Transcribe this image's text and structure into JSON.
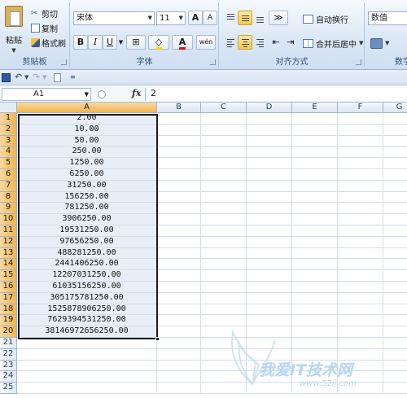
{
  "ribbon": {
    "clipboard": {
      "label": "剪贴板",
      "paste": "粘贴",
      "cut": "剪切",
      "copy": "复制",
      "format_painter": "格式刷"
    },
    "font": {
      "label": "字体",
      "font_name": "宋体",
      "font_size": "11",
      "grow": "A",
      "shrink": "A",
      "bold": "B",
      "italic": "I",
      "underline": "U",
      "font_color_letter": "A",
      "phonetic": "wén"
    },
    "alignment": {
      "label": "对齐方式",
      "wrap_text": "自动换行",
      "merge_center": "合并后居中"
    },
    "number": {
      "label": "数字",
      "format": "数值"
    }
  },
  "formula_bar": {
    "name_box": "A1",
    "fx": "fx",
    "value": "2"
  },
  "grid": {
    "columns": [
      "A",
      "B",
      "C",
      "D",
      "E",
      "F",
      "G"
    ],
    "rows": [
      "1",
      "2",
      "3",
      "4",
      "5",
      "6",
      "7",
      "8",
      "9",
      "10",
      "11",
      "12",
      "13",
      "14",
      "15",
      "16",
      "17",
      "18",
      "19",
      "20",
      "21",
      "22",
      "23",
      "24",
      "25"
    ],
    "column_a_values": [
      "2.00",
      "10.00",
      "50.00",
      "250.00",
      "1250.00",
      "6250.00",
      "31250.00",
      "156250.00",
      "781250.00",
      "3906250.00",
      "19531250.00",
      "97656250.00",
      "488281250.00",
      "2441406250.00",
      "12207031250.00",
      "61035156250.00",
      "305175781250.00",
      "1525878906250.00",
      "7629394531250.00",
      "38146972656250.00"
    ],
    "selection": "A1:A20"
  },
  "watermark": {
    "text": "我爱IT技术网",
    "url": "www.52ij.com"
  },
  "colors": {
    "ribbon": "#dde8f6",
    "selected_header": "#f1b451",
    "selection_fill": "#e8eef8"
  }
}
